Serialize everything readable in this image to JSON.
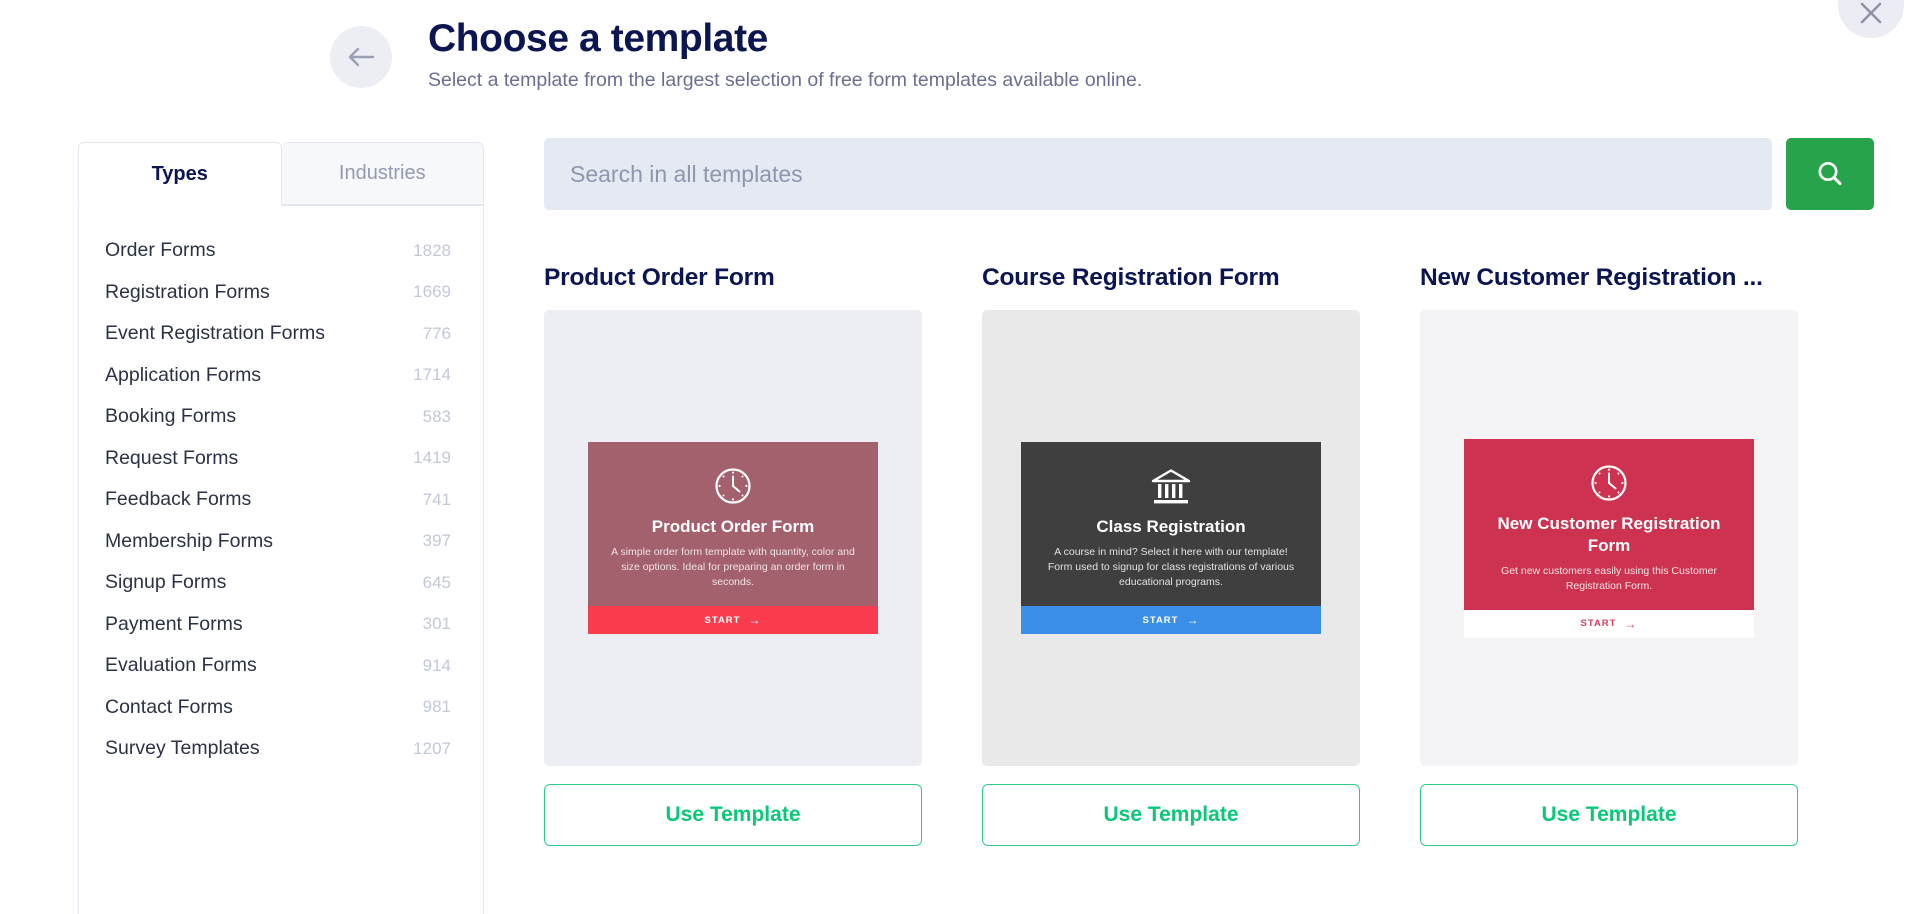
{
  "header": {
    "title": "Choose a template",
    "subtitle": "Select a template from the largest selection of free form templates available online.",
    "back_icon": "arrow-left-icon",
    "close_icon": "close-icon"
  },
  "sidebar": {
    "tabs": [
      {
        "label": "Types",
        "active": true
      },
      {
        "label": "Industries",
        "active": false
      }
    ],
    "items": [
      {
        "label": "Order Forms",
        "count": "1828"
      },
      {
        "label": "Registration Forms",
        "count": "1669"
      },
      {
        "label": "Event Registration Forms",
        "count": "776"
      },
      {
        "label": "Application Forms",
        "count": "1714"
      },
      {
        "label": "Booking Forms",
        "count": "583"
      },
      {
        "label": "Request Forms",
        "count": "1419"
      },
      {
        "label": "Feedback Forms",
        "count": "741"
      },
      {
        "label": "Membership Forms",
        "count": "397"
      },
      {
        "label": "Signup Forms",
        "count": "645"
      },
      {
        "label": "Payment Forms",
        "count": "301"
      },
      {
        "label": "Evaluation Forms",
        "count": "914"
      },
      {
        "label": "Contact Forms",
        "count": "981"
      },
      {
        "label": "Survey Templates",
        "count": "1207"
      }
    ]
  },
  "search": {
    "value": "",
    "placeholder": "Search in all templates",
    "button_icon": "search-icon"
  },
  "colors": {
    "brand_green": "#27a34c",
    "use_template_green": "#0ac878",
    "title_navy": "#0a1551"
  },
  "cards": [
    {
      "title": "Product Order Form",
      "use_label": "Use Template",
      "preview": {
        "icon": "clock-icon",
        "heading": "Product Order Form",
        "description": "A simple order form template with quantity, color and size options. Ideal for preparing an order form in seconds.",
        "start_label": "START",
        "body_color": "#a2616d",
        "bar_color": "#fa3c4f",
        "bar_text_color": "#ffffff"
      }
    },
    {
      "title": "Course Registration Form",
      "use_label": "Use Template",
      "preview": {
        "icon": "bank-icon",
        "heading": "Class Registration",
        "description": "A course in mind? Select it here with our template! Form used to signup for class registrations of various educational programs.",
        "start_label": "START",
        "body_color": "#3f3f3f",
        "bar_color": "#3b8fe8",
        "bar_text_color": "#ffffff"
      }
    },
    {
      "title": "New Customer Registration ...",
      "use_label": "Use Template",
      "preview": {
        "icon": "clock-icon",
        "heading": "New Customer Registration Form",
        "description": "Get new customers easily using this Customer Registration Form.",
        "start_label": "START",
        "body_color": "#cd3350",
        "bar_color": "#ffffff",
        "bar_text_color": "#d9405c"
      }
    }
  ]
}
